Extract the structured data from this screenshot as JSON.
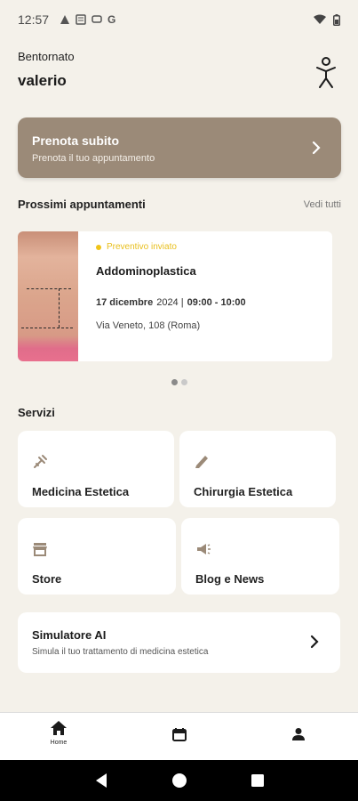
{
  "status": {
    "time": "12:57"
  },
  "welcome": {
    "label": "Bentornato",
    "name": "valerio"
  },
  "book": {
    "title": "Prenota subito",
    "subtitle": "Prenota il tuo appuntamento"
  },
  "appointments": {
    "section_title": "Prossimi appuntamenti",
    "see_all": "Vedi tutti",
    "card": {
      "status": "Preventivo inviato",
      "title": "Addominoplastica",
      "date": "17 dicembre",
      "year": "2024 |",
      "time": "09:00 - 10:00",
      "address": "Via Veneto, 108 (Roma)"
    }
  },
  "services": {
    "title": "Servizi",
    "items": [
      {
        "label": "Medicina Estetica",
        "icon": "syringe-icon"
      },
      {
        "label": "Chirurgia Estetica",
        "icon": "scalpel-icon"
      },
      {
        "label": "Store",
        "icon": "store-icon"
      },
      {
        "label": "Blog e News",
        "icon": "megaphone-icon"
      }
    ]
  },
  "simulator": {
    "title": "Simulatore AI",
    "subtitle": "Simula il tuo trattamento di medicina estetica"
  },
  "nav": {
    "home_label": "Home"
  },
  "colors": {
    "primary_card": "#9b8a78",
    "background": "#f4f1ea",
    "status_yellow": "#f0c419"
  }
}
